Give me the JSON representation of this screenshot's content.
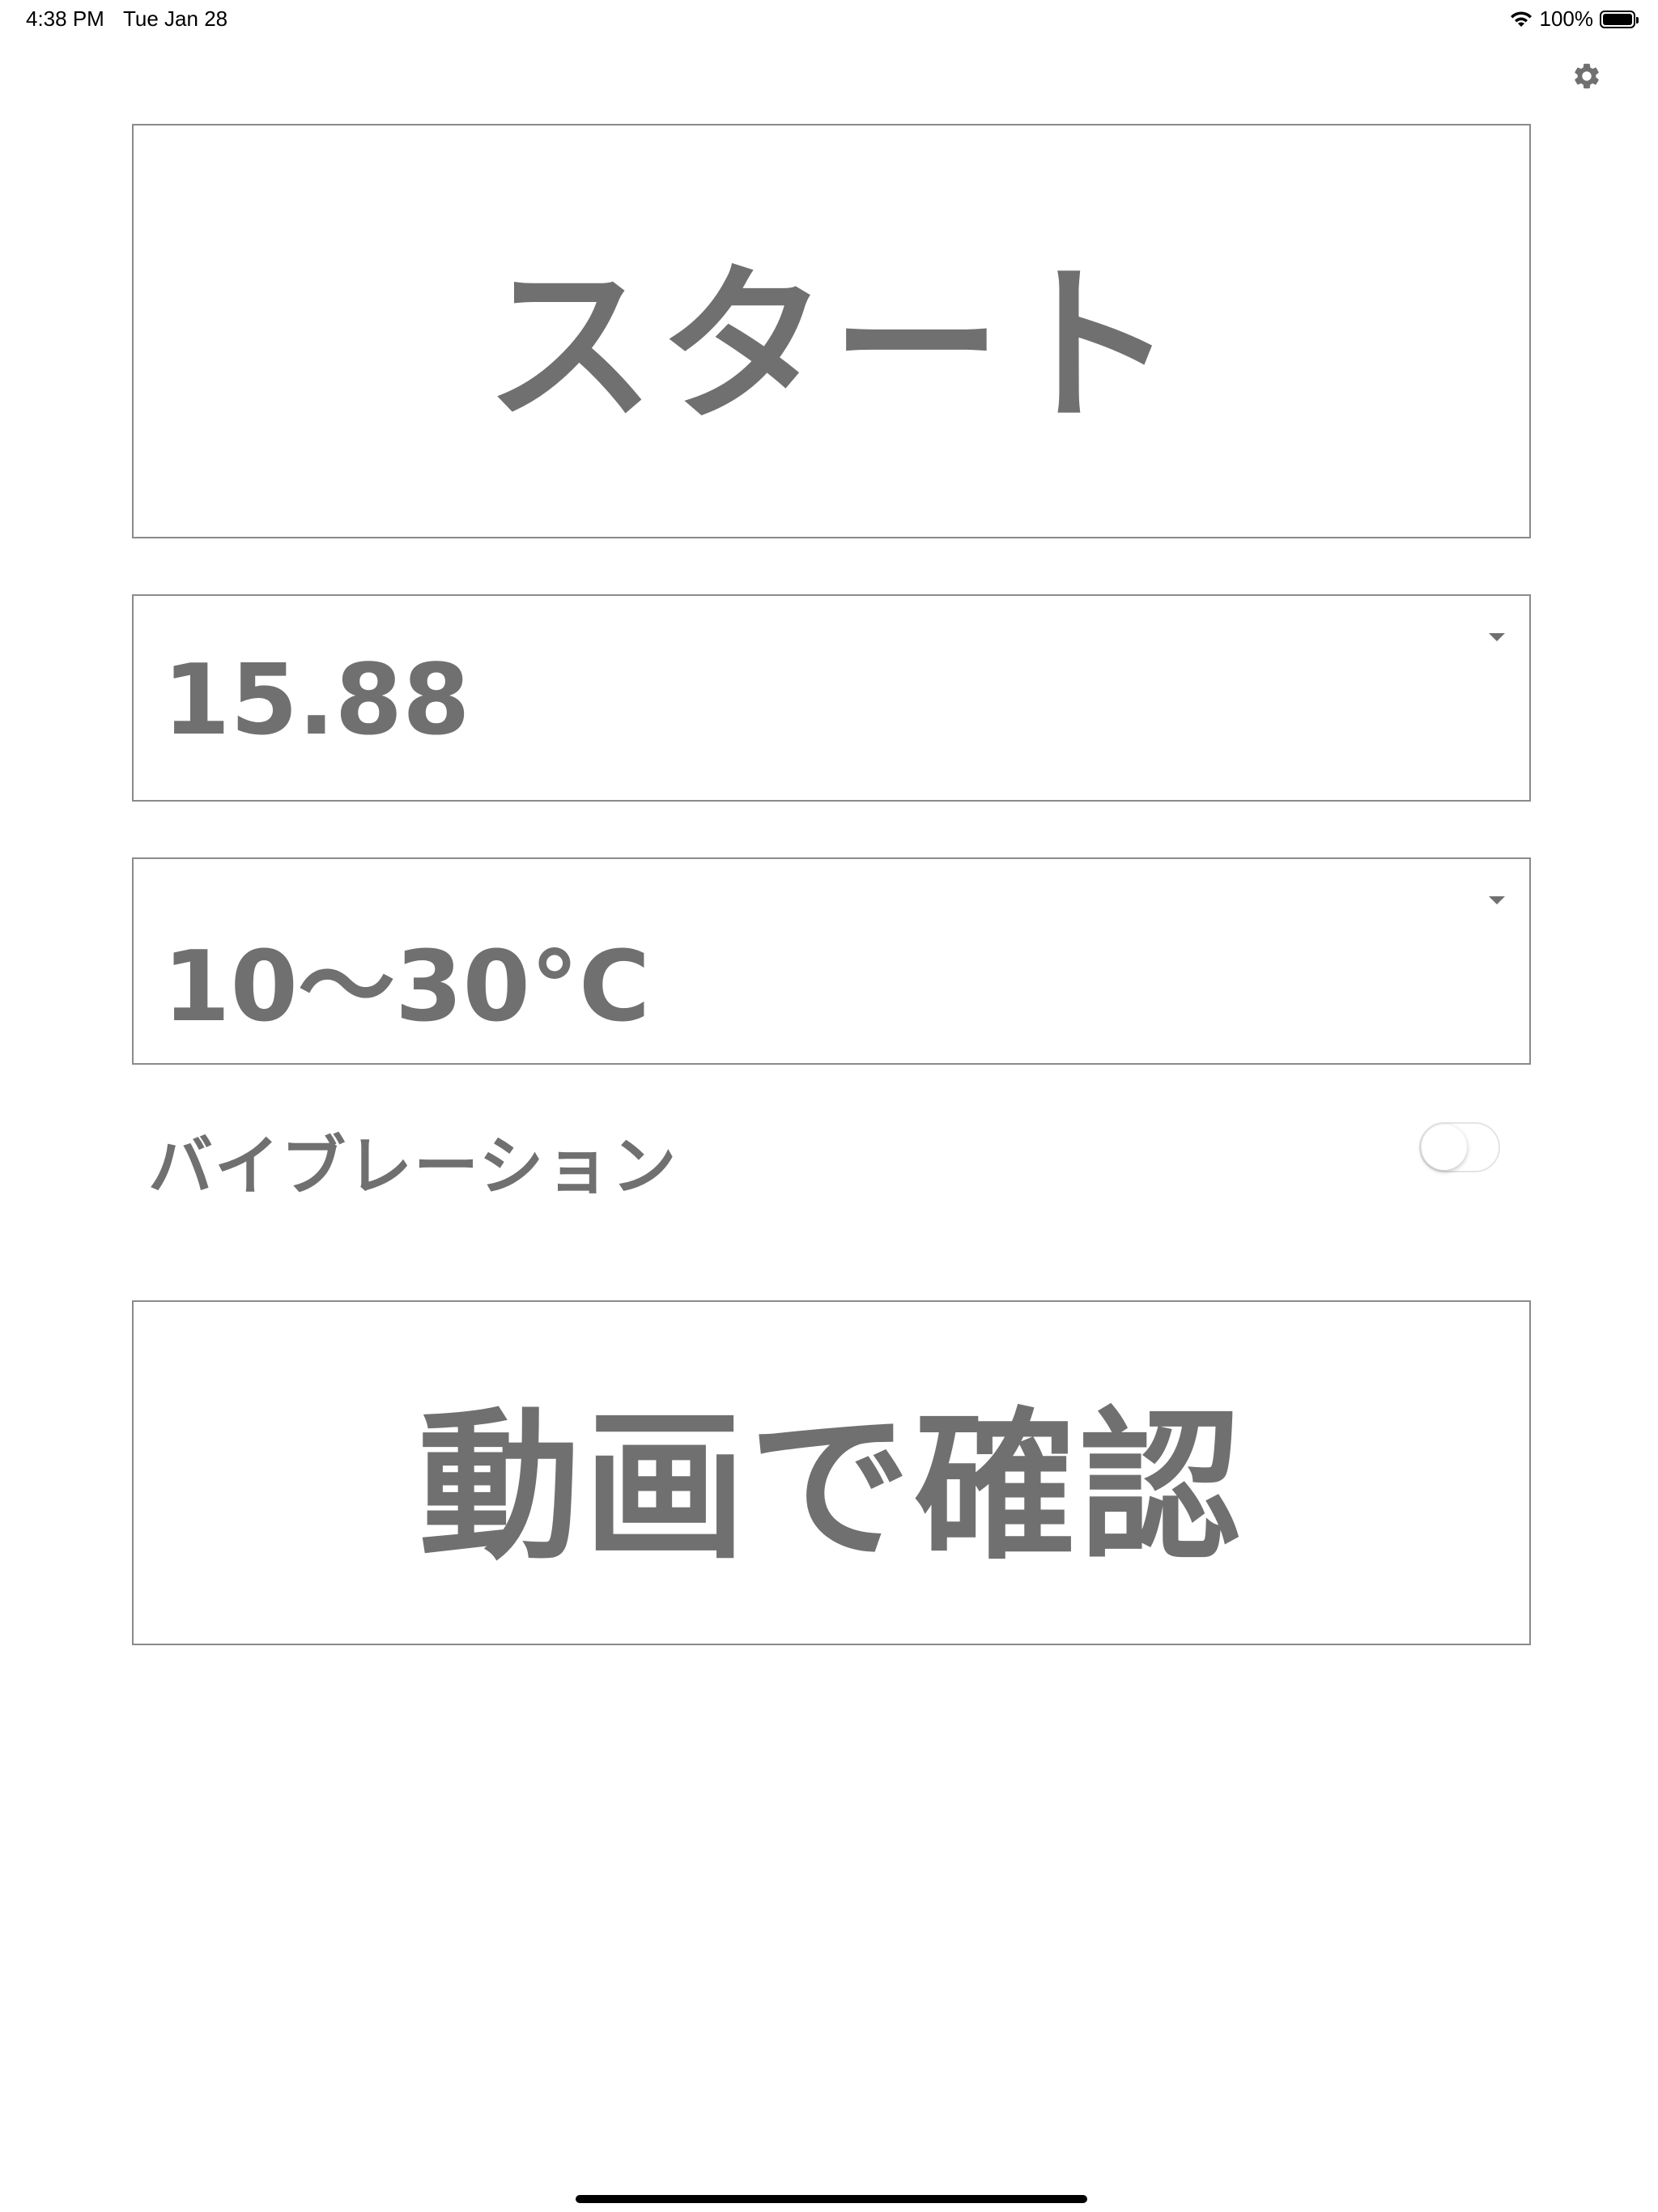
{
  "status_bar": {
    "time": "4:38 PM",
    "date": "Tue Jan 28",
    "battery_text": "100%",
    "battery_level": 1.0,
    "wifi_icon": "wifi-icon",
    "battery_icon": "battery-icon"
  },
  "settings": {
    "icon": "gear-icon"
  },
  "start_button": {
    "label": "スタート"
  },
  "value_select": {
    "value": "15.88",
    "icon": "dropdown-arrow-icon"
  },
  "temperature_select": {
    "value": "10〜30°C",
    "icon": "dropdown-arrow-icon"
  },
  "vibration": {
    "label": "バイブレーション",
    "enabled": false
  },
  "video_button": {
    "label": "動画で確認"
  },
  "colors": {
    "text": "#707070",
    "border": "#8a8a8a",
    "background": "#ffffff"
  }
}
